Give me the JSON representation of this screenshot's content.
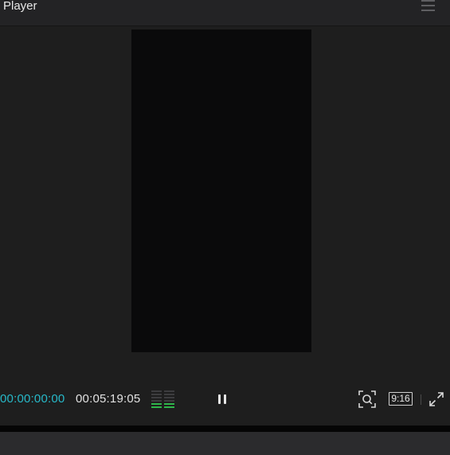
{
  "header": {
    "title": "Player",
    "menu_icon": "hamburger-menu-icon"
  },
  "player": {
    "current_time": "00:00:00:00",
    "total_time": "00:05:19:05",
    "aspect_ratio": "9:16",
    "state_icon": "pause-icon",
    "current_time_color": "#27b9c9",
    "meter_color": "#2fb54a",
    "meter_level": 0.35
  },
  "icons": {
    "zoom": "zoom-fit-icon",
    "fullscreen": "fullscreen-icon",
    "audio_meter": "audio-meter-icon"
  }
}
